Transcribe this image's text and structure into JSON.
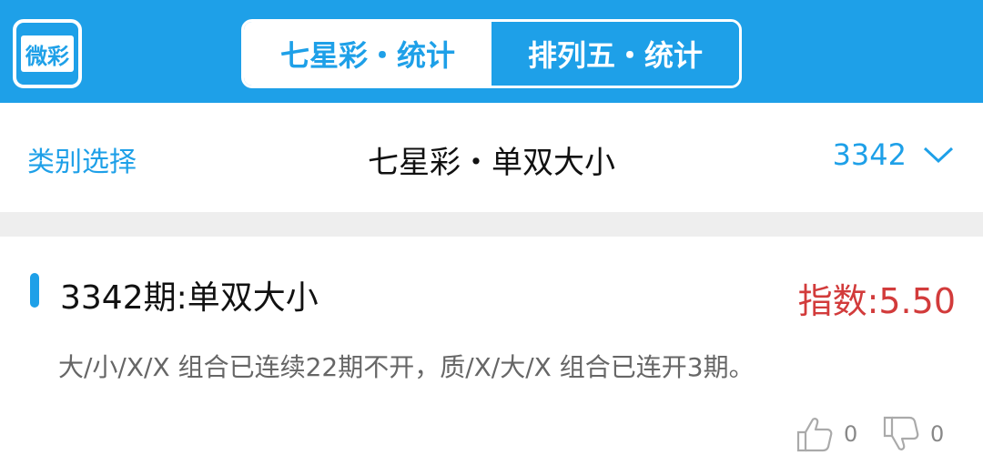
{
  "header": {
    "logo_text": "微彩",
    "tabs": [
      {
        "label": "七星彩・统计",
        "active": true
      },
      {
        "label": "排列五・统计",
        "active": false
      }
    ]
  },
  "subbar": {
    "category_label": "类别选择",
    "title": "七星彩・单双大小",
    "issue": "3342"
  },
  "card": {
    "title": "3342期:单双大小",
    "index": "指数:5.50",
    "description": "大/小/X/X 组合已连续22期不开，质/X/大/X 组合已连开3期。",
    "likes": "0",
    "dislikes": "0"
  },
  "colors": {
    "primary": "#1ea0e8",
    "index_red": "#d23b3b",
    "divider": "#eeeeee"
  }
}
